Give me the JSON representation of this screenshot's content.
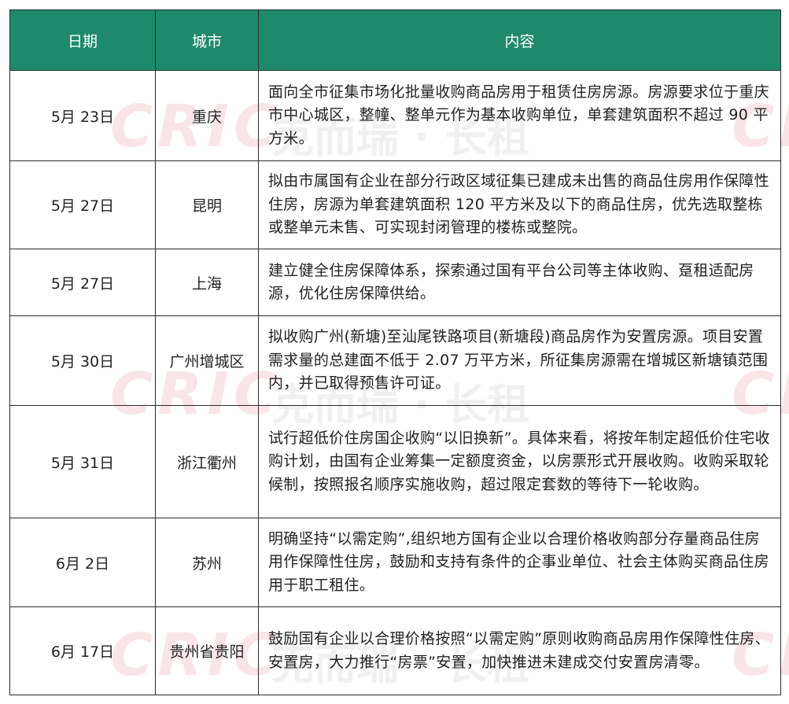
{
  "header": {
    "date": "日期",
    "city": "城市",
    "content": "内容"
  },
  "rows": [
    {
      "date": "5月 23日",
      "city": "重庆",
      "content": "面向全市征集市场化批量收购商品房用于租赁住房房源。房源要求位于重庆市中心城区，整幢、整单元作为基本收购单位，单套建筑面积不超过 90 平方米。"
    },
    {
      "date": "5月 27日",
      "city": "昆明",
      "content": "拟由市属国有企业在部分行政区域征集已建成未出售的商品住房用作保障性住房，房源为单套建筑面积 120 平方米及以下的商品住房，优先选取整栋或整单元未售、可实现封闭管理的楼栋或整院。"
    },
    {
      "date": "5月 27日",
      "city": "上海",
      "content": "建立健全住房保障体系，探索通过国有平台公司等主体收购、趸租适配房源，优化住房保障供给。"
    },
    {
      "date": "5月 30日",
      "city": "广州增城区",
      "content": "拟收购广州(新塘)至汕尾铁路项目(新塘段)商品房作为安置房源。项目安置需求量的总建面不低于 2.07 万平方米，所征集房源需在增城区新塘镇范围内，并已取得预售许可证。"
    },
    {
      "date": "5月 31日",
      "city": "浙江衢州",
      "content": "试行超低价住房国企收购“以旧换新”。具体来看，将按年制定超低价住宅收购计划，由国有企业筹集一定额度资金，以房票形式开展收购。收购采取轮候制，按照报名顺序实施收购，超过限定套数的等待下一轮收购。"
    },
    {
      "date": "6月 2日",
      "city": "苏州",
      "content": "明确坚持“以需定购”,组织地方国有企业以合理价格收购部分存量商品住房用作保障性住房，鼓励和支持有条件的企事业单位、社会主体购买商品住房用于职工租住。"
    },
    {
      "date": "6月 17日",
      "city": "贵州省贵阳",
      "content": "鼓励国有企业以合理价格按照“以需定购”原则收购商品房用作保障性住房、安置房，大力推行“房票”安置，加快推进未建成交付安置房清零。"
    }
  ],
  "watermark": {
    "logo": "CRIC",
    "text": "克而瑞 · 长租"
  },
  "colors": {
    "header_bg": "#1f8a6b",
    "header_text": "#ffffff",
    "border": "#2c2c2c"
  }
}
